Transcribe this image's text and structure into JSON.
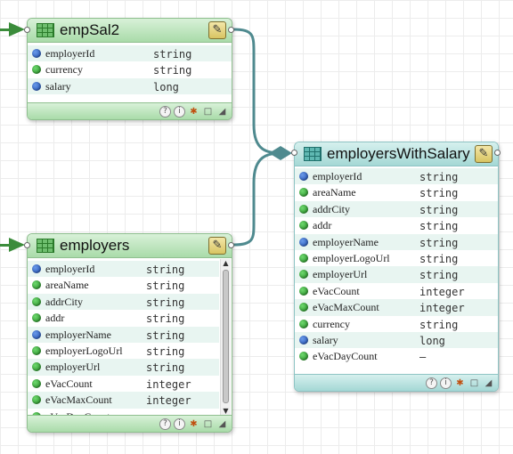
{
  "nodes": {
    "empSal2": {
      "title": "empSal2",
      "fields": [
        {
          "name": "employerId",
          "type": "string",
          "key": true
        },
        {
          "name": "currency",
          "type": "string",
          "key": false
        },
        {
          "name": "salary",
          "type": "long",
          "key": true
        }
      ]
    },
    "employers": {
      "title": "employers",
      "fields": [
        {
          "name": "employerId",
          "type": "string",
          "key": true
        },
        {
          "name": "areaName",
          "type": "string",
          "key": false
        },
        {
          "name": "addrCity",
          "type": "string",
          "key": false
        },
        {
          "name": "addr",
          "type": "string",
          "key": false
        },
        {
          "name": "employerName",
          "type": "string",
          "key": true
        },
        {
          "name": "employerLogoUrl",
          "type": "string",
          "key": false
        },
        {
          "name": "employerUrl",
          "type": "string",
          "key": false
        },
        {
          "name": "eVacCount",
          "type": "integer",
          "key": false
        },
        {
          "name": "eVacMaxCount",
          "type": "integer",
          "key": false
        },
        {
          "name": "eVacDayCount",
          "type": "–",
          "key": false
        }
      ]
    },
    "employersWithSalary": {
      "title": "employersWithSalary",
      "fields": [
        {
          "name": "employerId",
          "type": "string",
          "key": true
        },
        {
          "name": "areaName",
          "type": "string",
          "key": false
        },
        {
          "name": "addrCity",
          "type": "string",
          "key": false
        },
        {
          "name": "addr",
          "type": "string",
          "key": false
        },
        {
          "name": "employerName",
          "type": "string",
          "key": true
        },
        {
          "name": "employerLogoUrl",
          "type": "string",
          "key": false
        },
        {
          "name": "employerUrl",
          "type": "string",
          "key": false
        },
        {
          "name": "eVacCount",
          "type": "integer",
          "key": false
        },
        {
          "name": "eVacMaxCount",
          "type": "integer",
          "key": false
        },
        {
          "name": "currency",
          "type": "string",
          "key": false
        },
        {
          "name": "salary",
          "type": "long",
          "key": true
        },
        {
          "name": "eVacDayCount",
          "type": "–",
          "key": false
        }
      ]
    }
  },
  "footer_icons": {
    "help": "?",
    "info": "i",
    "debug": "✱",
    "comment": "□",
    "resize": "◢"
  },
  "edit_icon": "✎",
  "colors": {
    "link": "#4f8a8f",
    "input_arrow": "#3b8c3b",
    "node_header_green": "#a9dba9",
    "node_header_teal": "#a4d8d5",
    "key_dot": "#1d4db3",
    "field_dot": "#1f8a1f"
  }
}
